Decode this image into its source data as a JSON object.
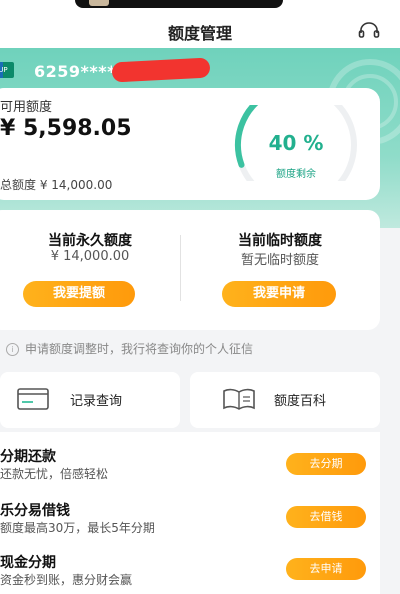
{
  "header": {
    "title": "额度管理"
  },
  "card": {
    "number": "6259****"
  },
  "credit": {
    "available_label": "可用额度",
    "available_amount": "¥ 5,598.05",
    "total_text": "总额度 ¥ 14,000.00",
    "remaining_percent_text": "40 %",
    "remaining_percent_value": 40,
    "remaining_label": "额度剩余"
  },
  "limits": {
    "permanent": {
      "title": "当前永久额度",
      "value": "¥ 14,000.00",
      "button": "我要提额"
    },
    "temporary": {
      "title": "当前临时额度",
      "value": "暂无临时额度",
      "button": "我要申请"
    }
  },
  "notice": "申请额度调整时，我行将查询你的个人征信",
  "quick_links": [
    {
      "label": "记录查询",
      "icon": "record-query-icon"
    },
    {
      "label": "额度百科",
      "icon": "book-icon"
    }
  ],
  "services": [
    {
      "title": "分期还款",
      "subtitle": "还款无忧，倍感轻松",
      "button": "去分期"
    },
    {
      "title": "乐分易借钱",
      "subtitle": "额度最高30万，最长5年分期",
      "button": "去借钱"
    },
    {
      "title": "现金分期",
      "subtitle": "资金秒到账，惠分财会赢",
      "button": "去申请"
    }
  ],
  "colors": {
    "brand_green": "#4fc9ae",
    "accent_orange": "#ff9a0b",
    "redaction": "#f2342f"
  }
}
